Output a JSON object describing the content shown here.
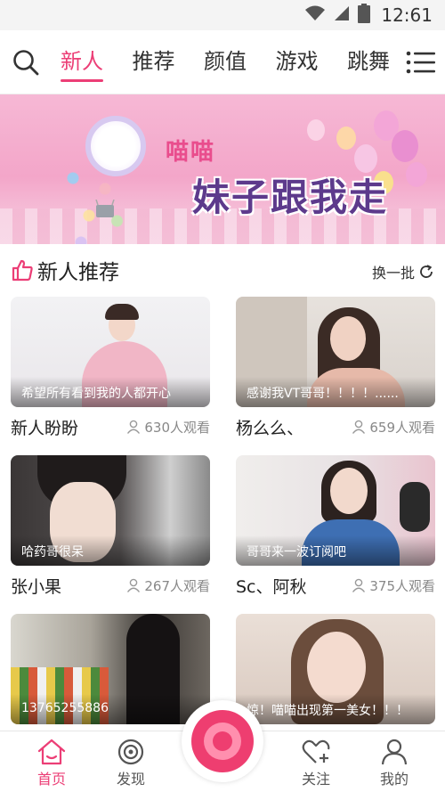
{
  "status_bar": {
    "time": "12:61"
  },
  "nav": {
    "tabs": [
      {
        "label": "新人",
        "active": true
      },
      {
        "label": "推荐",
        "active": false
      },
      {
        "label": "颜值",
        "active": false
      },
      {
        "label": "游戏",
        "active": false
      },
      {
        "label": "跳舞",
        "active": false
      }
    ]
  },
  "banner": {
    "line1": "喵喵",
    "line2": "妹子跟我走"
  },
  "section": {
    "title": "新人推荐",
    "refresh_label": "换一批"
  },
  "cards": [
    {
      "caption": "希望所有看到我的人都开心",
      "name": "新人盼盼",
      "viewers": "630人观看"
    },
    {
      "caption": "感谢我VT哥哥！！！！......",
      "name": "杨么么、",
      "viewers": "659人观看"
    },
    {
      "caption": "哈药哥很呆",
      "name": "张小果",
      "viewers": "267人观看"
    },
    {
      "caption": "哥哥来一波订阅吧",
      "name": "Sc、阿秋",
      "viewers": "375人观看"
    },
    {
      "caption": "13765255886",
      "name": "",
      "viewers": ""
    },
    {
      "caption": "惊！喵喵出现第一美女！！！",
      "name": "",
      "viewers": ""
    }
  ],
  "bottom_nav": {
    "items": [
      {
        "label": "首页",
        "icon": "home-icon",
        "active": true
      },
      {
        "label": "发现",
        "icon": "discover-icon",
        "active": false
      },
      {
        "label": "关注",
        "icon": "follow-heart-icon",
        "active": false
      },
      {
        "label": "我的",
        "icon": "profile-icon",
        "active": false
      }
    ]
  },
  "colors": {
    "accent": "#ec3e76",
    "text": "#222222",
    "muted": "#888888"
  }
}
